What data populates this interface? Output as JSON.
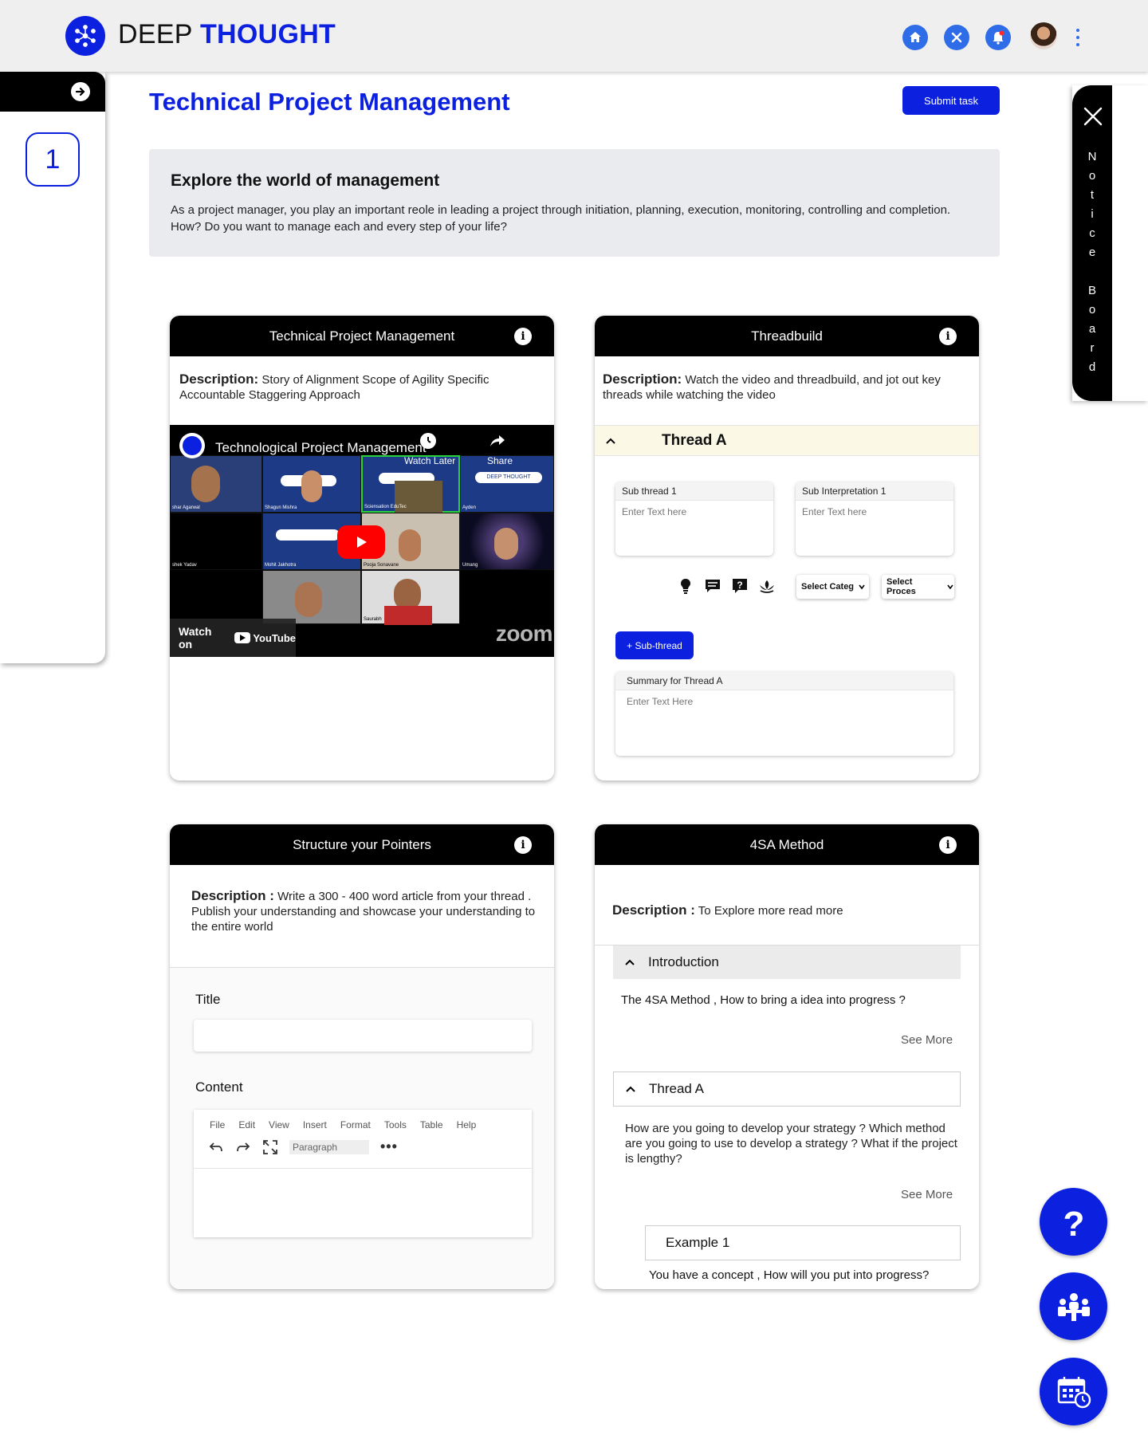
{
  "header": {
    "brand_part1": "DEEP",
    "brand_part2": "THOUGHT",
    "icons": [
      "home-icon",
      "tools-icon",
      "bell-icon",
      "avatar",
      "more-vertical-icon"
    ]
  },
  "sidebar": {
    "step": "1"
  },
  "page": {
    "title": "Technical Project Management",
    "submit_label": "Submit task"
  },
  "intro": {
    "heading": "Explore the world of management",
    "body": "As a project manager, you play an important reole in leading a project through initiation, planning, execution, monitoring, controlling and completion. How? Do you want to manage each and every step of your life?"
  },
  "notice_board": {
    "letters": [
      "N",
      "o",
      "t",
      "i",
      "c",
      "e",
      " ",
      "B",
      "o",
      "a",
      "r",
      "d"
    ]
  },
  "card_video": {
    "title": "Technical Project Management",
    "desc_label": "Description:",
    "desc_text": " Story of Alignment Scope of Agility Specific Accountable Staggering Approach",
    "video_title": "Technological Project Management",
    "watch_later": "Watch Later",
    "share": "Share",
    "watch_on": "Watch on",
    "youtube": "YouTube",
    "zoom": "zoom",
    "participants": [
      "shar Agarwal",
      "Shagun Mishra",
      "Sciensation EduTec",
      "Ayden",
      "shek Yadav",
      "Mohit Jakhotra",
      "Pooja Sonavane",
      "Umang",
      "Saurabh"
    ],
    "tile_badge": "DEEP THOUGHT"
  },
  "card_thread": {
    "title": "Threadbuild",
    "desc_label": "Description:",
    "desc_text": " Watch the video and threadbuild, and jot out key threads while watching the video",
    "thread_title": "Thread A",
    "sub_thread_label": "Sub thread 1",
    "sub_interp_label": "Sub Interpretation 1",
    "placeholder": "Enter Text here",
    "select_category": "Select Categ",
    "select_process": "Select Proces",
    "subthread_btn": "+ Sub-thread",
    "summary_label": "Summary for Thread A",
    "summary_placeholder": "Enter Text Here"
  },
  "card_structure": {
    "title": "Structure your Pointers",
    "desc_label": "Description :",
    "desc_text": " Write a 300 - 400 word article from your thread . Publish your understanding and showcase your understanding to the entire world",
    "title_label": "Title",
    "content_label": "Content",
    "menu": [
      "File",
      "Edit",
      "View",
      "Insert",
      "Format",
      "Tools",
      "Table",
      "Help"
    ],
    "paragraph": "Paragraph"
  },
  "card_4sa": {
    "title": "4SA Method",
    "desc_label": "Description :",
    "desc_text": " To Explore more read more",
    "intro_title": "Introduction",
    "intro_text": "The 4SA Method , How to bring a idea into progress ?",
    "see_more": "See More",
    "thread_title": "Thread A",
    "thread_text": "How are you going to develop your strategy ? Which method are you going to use to develop a strategy ? What if the project is lengthy?",
    "example_title": "Example 1",
    "example_text": "You have a concept , How will you put into progress?"
  },
  "fabs": [
    "help-icon",
    "meeting-icon",
    "calendar-icon"
  ],
  "colors": {
    "brand_blue": "#0c21e0",
    "header_icon_blue": "#2f6de8",
    "thread_bar": "#fbf8e6"
  }
}
